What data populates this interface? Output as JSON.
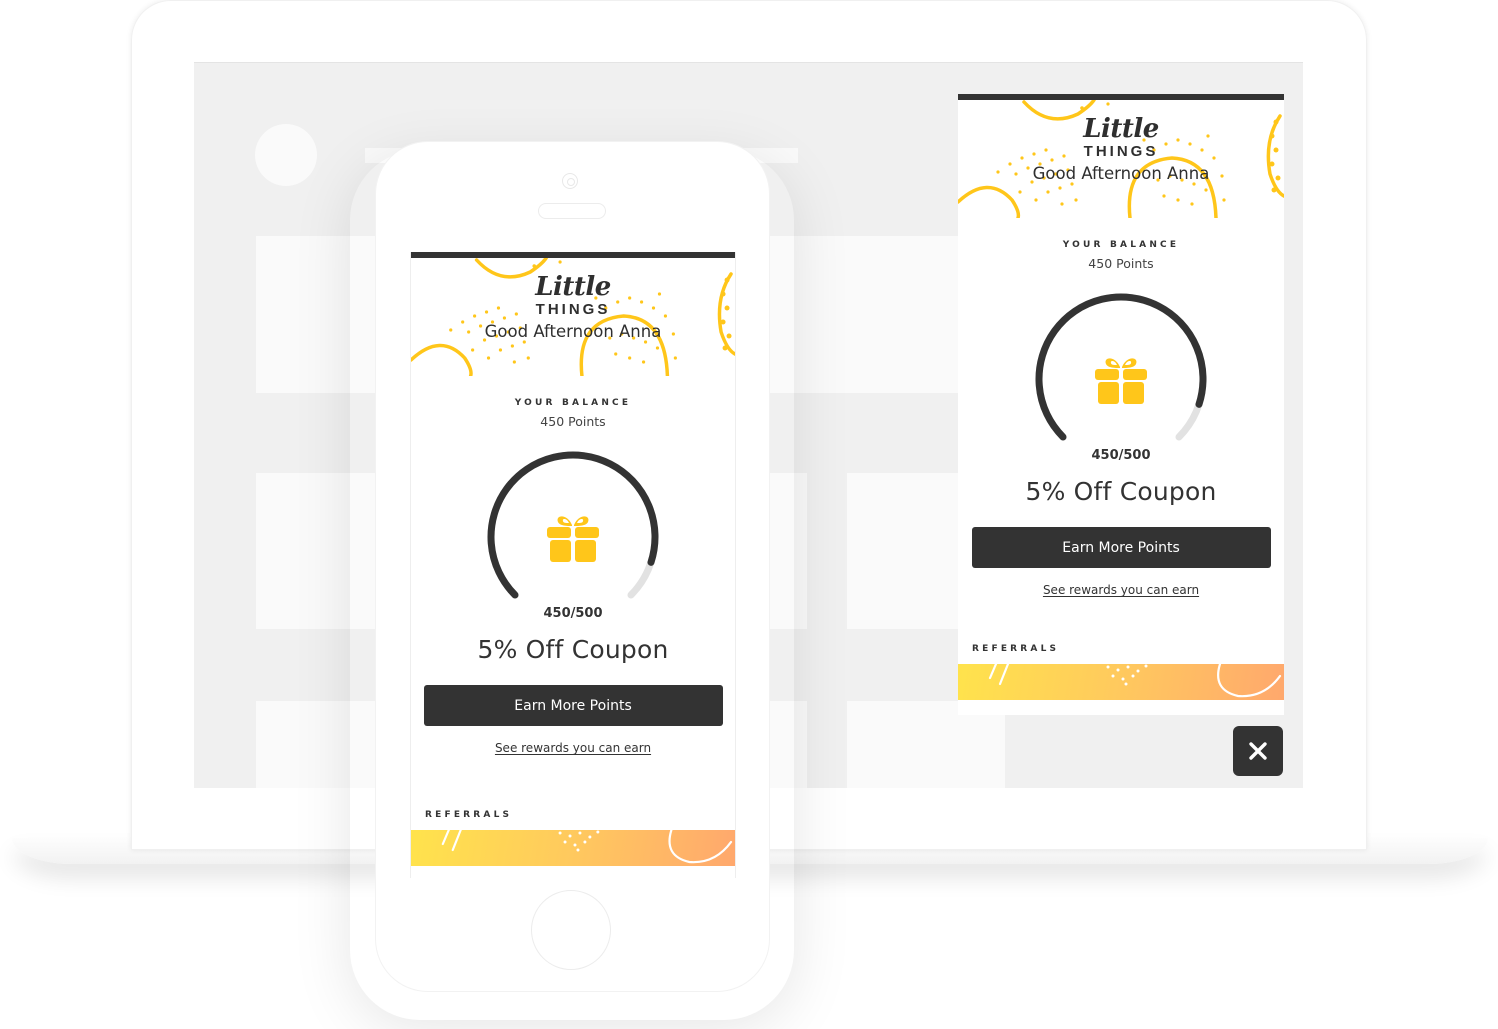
{
  "brand": {
    "name_script": "Little",
    "name_caps": "THINGS",
    "accent_color": "#FFC61A",
    "dark_color": "#333333"
  },
  "widget": {
    "greeting": "Good Afternoon Anna",
    "balance_label": "YOUR BALANCE",
    "balance_value": "450 Points",
    "progress": {
      "current": 450,
      "target": 500,
      "text": "450/500",
      "fraction": 0.9
    },
    "reward_title": "5% Off Coupon",
    "earn_button": "Earn More Points",
    "rewards_link": "See rewards you can earn",
    "referrals_label": "REFERRALS",
    "icons": {
      "gift": "gift-icon",
      "close": "close-icon"
    }
  },
  "launcher": {
    "close_label": "Close"
  }
}
